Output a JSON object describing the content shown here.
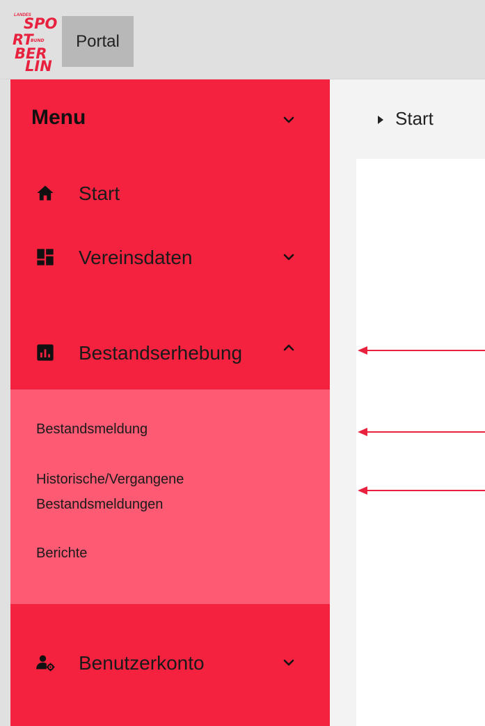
{
  "header": {
    "logo": {
      "small_top": "LANDES",
      "line1": "SPO",
      "line2": "RT",
      "line2_small": "BUND",
      "line3": "BER",
      "line4": "LIN"
    },
    "portal_label": "Portal"
  },
  "sidebar": {
    "menu_title": "Menu",
    "items": [
      {
        "label": "Start",
        "icon": "home-icon"
      },
      {
        "label": "Vereinsdaten",
        "icon": "dashboard-icon"
      },
      {
        "label": "Bestandserhebung",
        "icon": "bar-chart-icon"
      },
      {
        "label": "Benutzerkonto",
        "icon": "user-settings-icon"
      }
    ],
    "subitems": [
      {
        "label": "Bestandsmeldung"
      },
      {
        "label": "Historische/Vergangene"
      },
      {
        "label": "Bestandsmeldungen"
      },
      {
        "label": "Berichte"
      }
    ]
  },
  "breadcrumb": {
    "label": "Start"
  },
  "colors": {
    "sidebar_red": "#f4213f",
    "submenu_pink": "#ff5a73",
    "arrow_red": "#e8213f"
  }
}
